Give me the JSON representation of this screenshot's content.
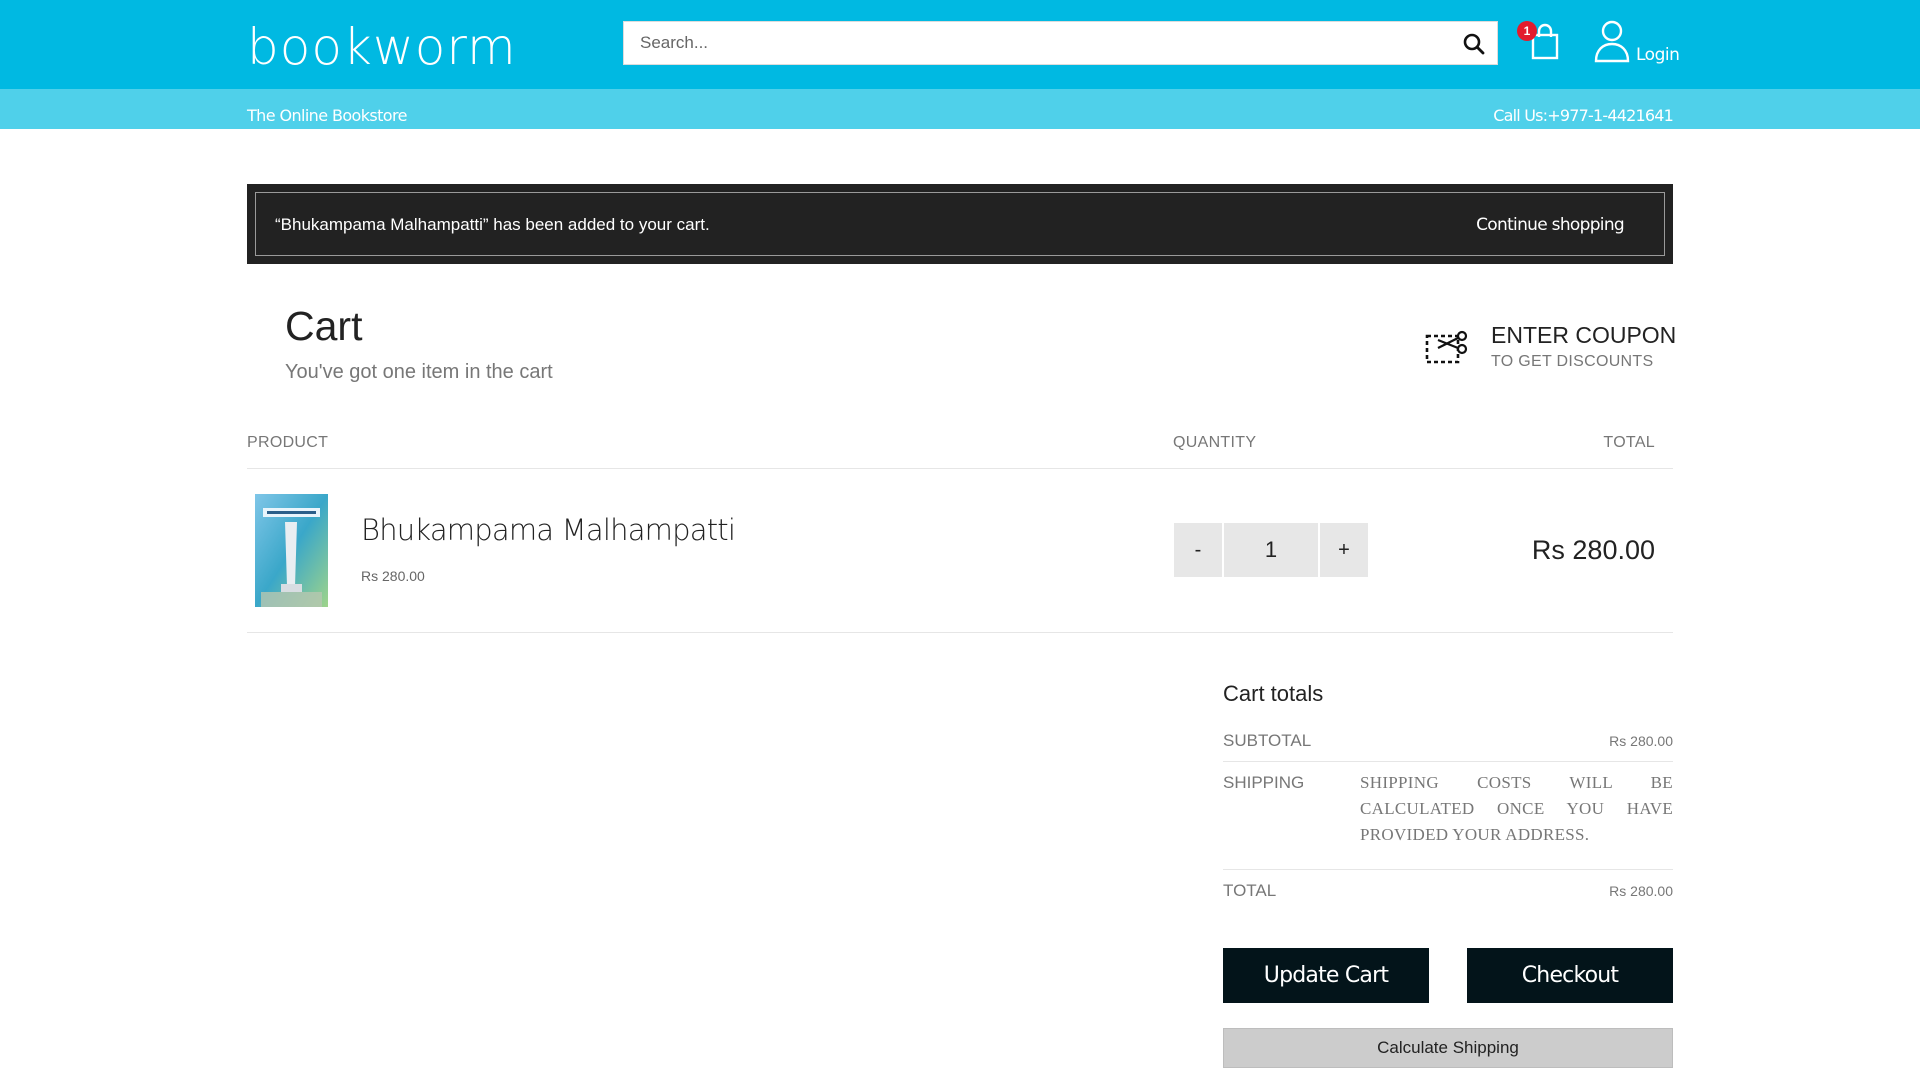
{
  "header": {
    "logo": "bookworm",
    "search_placeholder": "Search...",
    "search_value": "",
    "cart_count": "1",
    "login_label": "Login",
    "tagline": "The Online Bookstore",
    "phone": "Call Us:+977-1-4421641",
    "brand_color": "#00b9e2",
    "subbar_color": "#4fd0ea",
    "badge_color": "#e21b2d"
  },
  "notice": {
    "message": "“Bhukampama Malhampatti” has been added to your cart.",
    "continue_label": "Continue shopping"
  },
  "cart": {
    "title": "Cart",
    "subtitle": "You've got one item in the cart",
    "coupon_title": "ENTER COUPON",
    "coupon_subtitle": "TO GET DISCOUNTS",
    "columns": {
      "product": "PRODUCT",
      "quantity": "QUANTITY",
      "total": "TOTAL"
    },
    "items": [
      {
        "name": "Bhukampama Malhampatti",
        "price": "Rs 280.00",
        "quantity": "1",
        "total": "Rs 280.00",
        "minus": "-",
        "plus": "+"
      }
    ]
  },
  "totals": {
    "title": "Cart totals",
    "subtotal_label": "SUBTOTAL",
    "subtotal_value": "Rs 280.00",
    "shipping_label": "SHIPPING",
    "shipping_note": "SHIPPING COSTS WILL BE CALCULATED ONCE YOU HAVE PROVIDED YOUR ADDRESS.",
    "total_label": "TOTAL",
    "total_value": "Rs 280.00",
    "update_label": "Update Cart",
    "checkout_label": "Checkout",
    "calc_shipping_label": "Calculate Shipping"
  }
}
